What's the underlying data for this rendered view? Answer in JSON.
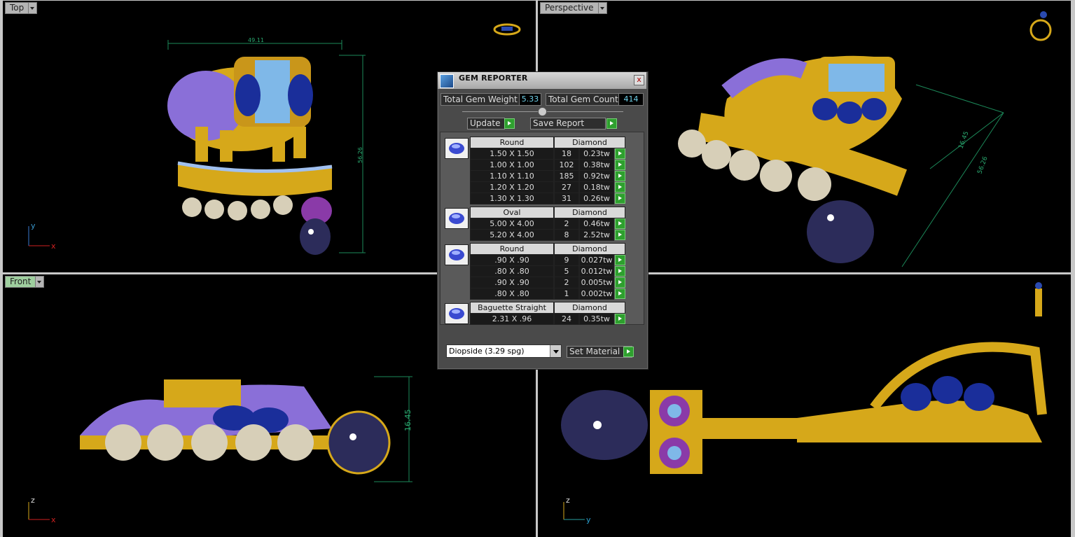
{
  "viewports": {
    "top": {
      "label": "Top",
      "dimension_width": "49.11",
      "dimension_height": "56.26",
      "axis_a": "y",
      "axis_b": "x"
    },
    "perspective": {
      "label": "Perspective",
      "dimension_a": "16.45",
      "dimension_b": "56.26"
    },
    "front": {
      "label": "Front",
      "dimension_height": "16.45",
      "axis_a": "z",
      "axis_b": "x"
    },
    "side": {
      "label": "",
      "axis_a": "z",
      "axis_b": "y"
    }
  },
  "gem_reporter": {
    "title": "GEM REPORTER",
    "close": "x",
    "total_weight_label": "Total Gem Weight",
    "total_weight_value": "5.33",
    "total_count_label": "Total Gem Count",
    "total_count_value": "414",
    "update_label": "Update",
    "save_label": "Save Report",
    "groups": [
      {
        "shape": "Round",
        "material": "Diamond",
        "rows": [
          {
            "size": "1.50 X 1.50",
            "count": "18",
            "weight": "0.23tw"
          },
          {
            "size": "1.00 X 1.00",
            "count": "102",
            "weight": "0.38tw"
          },
          {
            "size": "1.10 X 1.10",
            "count": "185",
            "weight": "0.92tw"
          },
          {
            "size": "1.20 X 1.20",
            "count": "27",
            "weight": "0.18tw"
          },
          {
            "size": "1.30 X 1.30",
            "count": "31",
            "weight": "0.26tw"
          }
        ]
      },
      {
        "shape": "Oval",
        "material": "Diamond",
        "rows": [
          {
            "size": "5.00 X 4.00",
            "count": "2",
            "weight": "0.46tw"
          },
          {
            "size": "5.20 X 4.00",
            "count": "8",
            "weight": "2.52tw"
          }
        ]
      },
      {
        "shape": "Round",
        "material": "Diamond",
        "rows": [
          {
            "size": ".90 X .90",
            "count": "9",
            "weight": "0.027tw"
          },
          {
            "size": ".80 X .80",
            "count": "5",
            "weight": "0.012tw"
          },
          {
            "size": ".90 X .90",
            "count": "2",
            "weight": "0.005tw"
          },
          {
            "size": ".80 X .80",
            "count": "1",
            "weight": "0.002tw"
          }
        ]
      },
      {
        "shape": "Baguette Straight",
        "material": "Diamond",
        "rows": [
          {
            "size": "2.31 X .96",
            "count": "24",
            "weight": "0.35tw"
          }
        ]
      }
    ],
    "material_select": "Diopside     (3.29 spg)",
    "set_material_label": "Set Material"
  }
}
